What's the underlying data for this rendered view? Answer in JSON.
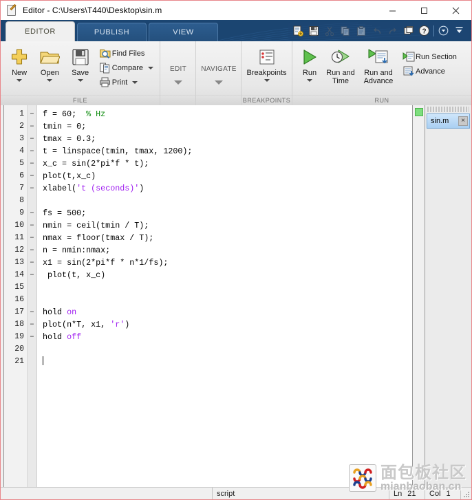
{
  "window": {
    "title": "Editor - C:\\Users\\T440\\Desktop\\sin.m",
    "icon": "editor-document-icon",
    "minimize_label": "—",
    "maximize_label": "☐",
    "close_label": "✕"
  },
  "ribbon": {
    "tabs": [
      {
        "label": "EDITOR",
        "active": true
      },
      {
        "label": "PUBLISH",
        "active": false
      },
      {
        "label": "VIEW",
        "active": false
      }
    ],
    "quick_access": [
      "new-script-icon",
      "save-icon",
      "cut-icon",
      "copy-icon",
      "paste-icon",
      "undo-icon",
      "redo-icon",
      "switch-windows-icon",
      "help-icon"
    ],
    "quick_access_overflow": "customize-quick-access-icon",
    "minimize_ribbon": "minimize-ribbon-icon",
    "groups": [
      {
        "name": "FILE",
        "big_buttons": [
          {
            "label": "New",
            "icon": "new-file-icon",
            "has_menu": true
          },
          {
            "label": "Open",
            "icon": "open-folder-icon",
            "has_menu": true
          },
          {
            "label": "Save",
            "icon": "save-disk-icon",
            "has_menu": true
          }
        ],
        "small_buttons": [
          {
            "label": "Find Files",
            "icon": "find-files-icon",
            "has_menu": false
          },
          {
            "label": "Compare",
            "icon": "compare-icon",
            "has_menu": true
          },
          {
            "label": "Print",
            "icon": "print-icon",
            "has_menu": true
          }
        ]
      },
      {
        "name": "EDIT",
        "collapsed_label": "EDIT"
      },
      {
        "name": "NAVIGATE",
        "collapsed_label": "NAVIGATE"
      },
      {
        "name": "BREAKPOINTS",
        "big_buttons": [
          {
            "label": "Breakpoints",
            "icon": "breakpoints-icon",
            "has_menu": true
          }
        ]
      },
      {
        "name": "RUN",
        "big_buttons": [
          {
            "label": "Run",
            "icon": "run-icon",
            "has_menu": true
          },
          {
            "label": "Run and\nTime",
            "icon": "run-and-time-icon",
            "has_menu": false
          },
          {
            "label": "Run and\nAdvance",
            "icon": "run-and-advance-icon",
            "has_menu": false
          }
        ],
        "small_buttons": [
          {
            "label": "Run Section",
            "icon": "run-section-icon",
            "has_menu": false
          },
          {
            "label": "Advance",
            "icon": "advance-icon",
            "has_menu": false
          }
        ]
      }
    ]
  },
  "editor": {
    "lines": [
      {
        "n": 1,
        "mark": "–",
        "segments": [
          {
            "t": "f = 60;  ",
            "c": "plain"
          },
          {
            "t": "% Hz",
            "c": "comment"
          }
        ]
      },
      {
        "n": 2,
        "mark": "–",
        "segments": [
          {
            "t": "tmin = 0;",
            "c": "plain"
          }
        ]
      },
      {
        "n": 3,
        "mark": "–",
        "segments": [
          {
            "t": "tmax = 0.3;",
            "c": "plain"
          }
        ]
      },
      {
        "n": 4,
        "mark": "–",
        "segments": [
          {
            "t": "t = linspace(tmin, tmax, 1200);",
            "c": "plain"
          }
        ]
      },
      {
        "n": 5,
        "mark": "–",
        "segments": [
          {
            "t": "x_c = sin(2*pi*f * t);",
            "c": "plain"
          }
        ]
      },
      {
        "n": 6,
        "mark": "–",
        "segments": [
          {
            "t": "plot(t,x_c)",
            "c": "plain"
          }
        ]
      },
      {
        "n": 7,
        "mark": "–",
        "segments": [
          {
            "t": "xlabel(",
            "c": "plain"
          },
          {
            "t": "'t (seconds)'",
            "c": "string"
          },
          {
            "t": ")",
            "c": "plain"
          }
        ]
      },
      {
        "n": 8,
        "mark": "",
        "segments": []
      },
      {
        "n": 9,
        "mark": "–",
        "segments": [
          {
            "t": "fs = 500;",
            "c": "plain"
          }
        ]
      },
      {
        "n": 10,
        "mark": "–",
        "segments": [
          {
            "t": "nmin = ceil(tmin / T);",
            "c": "plain"
          }
        ]
      },
      {
        "n": 11,
        "mark": "–",
        "segments": [
          {
            "t": "nmax = floor(tmax / T);",
            "c": "plain"
          }
        ]
      },
      {
        "n": 12,
        "mark": "–",
        "segments": [
          {
            "t": "n = nmin:nmax;",
            "c": "plain"
          }
        ]
      },
      {
        "n": 13,
        "mark": "–",
        "segments": [
          {
            "t": "x1 = sin(2*pi*f * n*1/fs);",
            "c": "plain"
          }
        ]
      },
      {
        "n": 14,
        "mark": "–",
        "segments": [
          {
            "t": " plot(t, x_c)",
            "c": "plain"
          }
        ]
      },
      {
        "n": 15,
        "mark": "",
        "segments": []
      },
      {
        "n": 16,
        "mark": "",
        "segments": []
      },
      {
        "n": 17,
        "mark": "–",
        "segments": [
          {
            "t": "hold ",
            "c": "plain"
          },
          {
            "t": "on",
            "c": "keyword"
          }
        ]
      },
      {
        "n": 18,
        "mark": "–",
        "segments": [
          {
            "t": "plot(n*T, x1, ",
            "c": "plain"
          },
          {
            "t": "'r'",
            "c": "string"
          },
          {
            "t": ")",
            "c": "plain"
          }
        ]
      },
      {
        "n": 19,
        "mark": "–",
        "segments": [
          {
            "t": "hold ",
            "c": "plain"
          },
          {
            "t": "off",
            "c": "keyword"
          }
        ]
      },
      {
        "n": 20,
        "mark": "",
        "segments": []
      },
      {
        "n": 21,
        "mark": "",
        "segments": [],
        "cursor": true
      }
    ],
    "analyzer_status": "ok-green-indicator",
    "colors": {
      "comment": "#0a8a0a",
      "string": "#a020f0",
      "keyword": "#a020f0",
      "plain": "#000000"
    }
  },
  "document_panel": {
    "tab_label": "sin.m",
    "close_label": "×"
  },
  "status_bar": {
    "file_type": "script",
    "line_label": "Ln",
    "line_value": "21",
    "col_label": "Col",
    "col_value": "1"
  },
  "watermark": {
    "chinese": "面包板社区",
    "latin": "mianbaoban.cn"
  }
}
